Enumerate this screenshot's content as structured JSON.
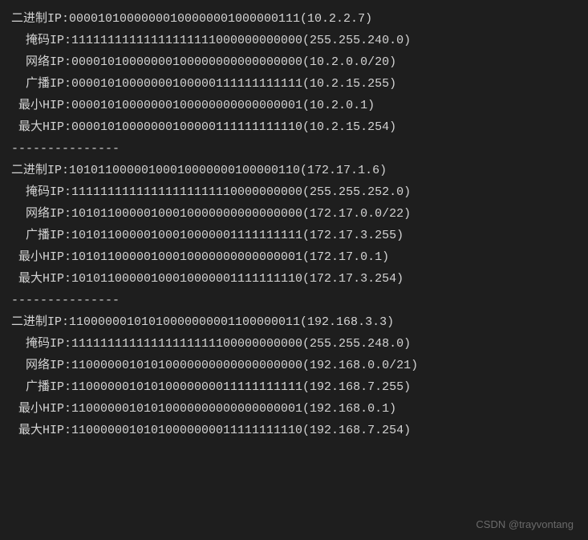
{
  "blocks": [
    {
      "lines": [
        {
          "label": "二进制IP",
          "binary": "00001010000000100000001000000111",
          "decimal": "10.2.2.7"
        },
        {
          "label": "  掩码IP",
          "binary": "11111111111111111111000000000000",
          "decimal": "255.255.240.0"
        },
        {
          "label": "  网络IP",
          "binary": "00001010000000100000000000000000",
          "decimal": "10.2.0.0/20"
        },
        {
          "label": "  广播IP",
          "binary": "00001010000000100000111111111111",
          "decimal": "10.2.15.255"
        },
        {
          "label": " 最小HIP",
          "binary": "00001010000000100000000000000001",
          "decimal": "10.2.0.1"
        },
        {
          "label": " 最大HIP",
          "binary": "00001010000000100000111111111110",
          "decimal": "10.2.15.254"
        }
      ]
    },
    {
      "lines": [
        {
          "label": "二进制IP",
          "binary": "10101100000100010000000100000110",
          "decimal": "172.17.1.6"
        },
        {
          "label": "  掩码IP",
          "binary": "11111111111111111111110000000000",
          "decimal": "255.255.252.0"
        },
        {
          "label": "  网络IP",
          "binary": "10101100000100010000000000000000",
          "decimal": "172.17.0.0/22"
        },
        {
          "label": "  广播IP",
          "binary": "10101100000100010000001111111111",
          "decimal": "172.17.3.255"
        },
        {
          "label": " 最小HIP",
          "binary": "10101100000100010000000000000001",
          "decimal": "172.17.0.1"
        },
        {
          "label": " 最大HIP",
          "binary": "10101100000100010000001111111110",
          "decimal": "172.17.3.254"
        }
      ]
    },
    {
      "lines": [
        {
          "label": "二进制IP",
          "binary": "11000000101010000000001100000011",
          "decimal": "192.168.3.3"
        },
        {
          "label": "  掩码IP",
          "binary": "11111111111111111111100000000000",
          "decimal": "255.255.248.0"
        },
        {
          "label": "  网络IP",
          "binary": "11000000101010000000000000000000",
          "decimal": "192.168.0.0/21"
        },
        {
          "label": "  广播IP",
          "binary": "11000000101010000000011111111111",
          "decimal": "192.168.7.255"
        },
        {
          "label": " 最小HIP",
          "binary": "11000000101010000000000000000001",
          "decimal": "192.168.0.1"
        },
        {
          "label": " 最大HIP",
          "binary": "11000000101010000000011111111110",
          "decimal": "192.168.7.254"
        }
      ]
    }
  ],
  "separator": "---------------",
  "watermark": "CSDN @trayvontang"
}
